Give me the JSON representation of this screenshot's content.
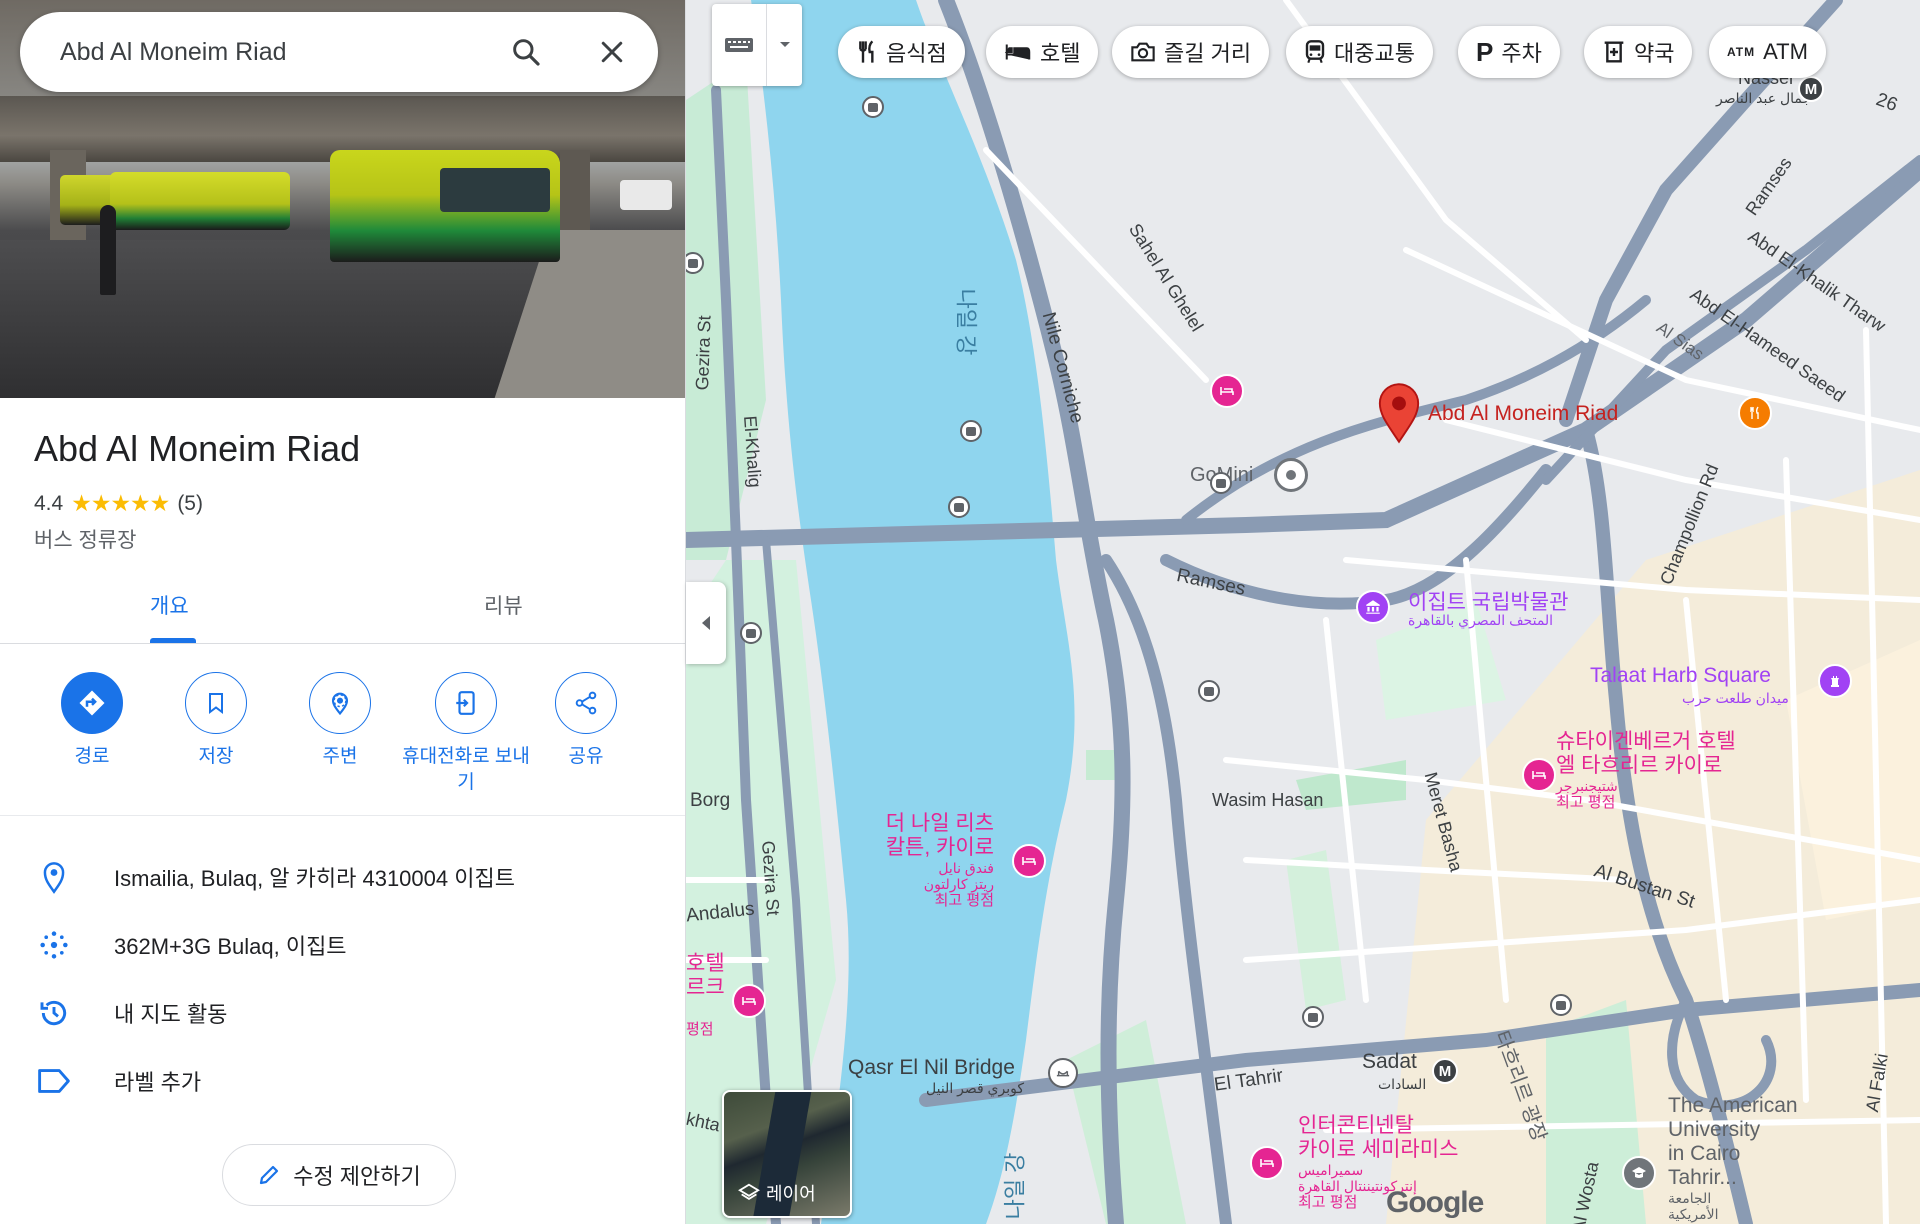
{
  "search": {
    "value": "Abd Al Moneim Riad",
    "search_icon": "search-icon",
    "close_icon": "close-icon"
  },
  "place": {
    "title": "Abd Al Moneim Riad",
    "rating": "4.4",
    "stars": "★★★★★",
    "review_count": "(5)",
    "category": "버스 정류장"
  },
  "tabs": [
    {
      "label": "개요",
      "active": true
    },
    {
      "label": "리뷰",
      "active": false
    }
  ],
  "actions": [
    {
      "label": "경로",
      "icon": "directions-icon"
    },
    {
      "label": "저장",
      "icon": "bookmark-icon"
    },
    {
      "label": "주변",
      "icon": "nearby-icon"
    },
    {
      "label": "휴대전화로 보내기",
      "icon": "send-to-phone-icon"
    },
    {
      "label": "공유",
      "icon": "share-icon"
    }
  ],
  "info": [
    {
      "icon": "location-pin-icon",
      "text": "Ismailia, Bulaq, 알 카히라 4310004 이집트"
    },
    {
      "icon": "plus-code-icon",
      "text": "362M+3G Bulaq, 이집트"
    },
    {
      "icon": "history-icon",
      "text": "내 지도 활동"
    },
    {
      "icon": "label-icon",
      "text": "라벨 추가"
    }
  ],
  "suggest_edit": "수정 제안하기",
  "map": {
    "chips": [
      {
        "label": "음식점",
        "icon": "restaurant-icon"
      },
      {
        "label": "호텔",
        "icon": "hotel-icon"
      },
      {
        "label": "즐길 거리",
        "icon": "camera-icon"
      },
      {
        "label": "대중교통",
        "icon": "transit-icon"
      },
      {
        "label": "주차",
        "icon": "parking-icon"
      },
      {
        "label": "약국",
        "icon": "pharmacy-icon"
      },
      {
        "label": "ATM",
        "icon": "atm-icon"
      }
    ],
    "layers_label": "레이어",
    "labels": {
      "nile_kr": "나일 강",
      "nile_kr_bottom": "나일 강",
      "nile_corniche": "Nile Corniche",
      "sahel": "Sahel Al Ghelel",
      "gezira_st_top": "Gezira St",
      "gezira_st_bottom": "Gezira St",
      "el_khalig": "El-Khalig",
      "gomini": "GoMini",
      "selected_place": "Abd Al Moneim Riad",
      "ramses_road": "Ramses",
      "ramses_street": "Ramses",
      "abd_el_khalik": "Abd El-Khalik Tharw",
      "abd_el_hameed": "Abd El-Hameed Saeed",
      "al_sias": "Al Sias",
      "champollion": "Champollion Rd",
      "museum_kr": "이집트 국립박물관",
      "museum_ar": "المتحف المصري بالقاهرة",
      "talaat_en": "Talaat Harb Square",
      "talaat_ar": "ميدان طلعت حرب",
      "steigen_1": "슈타이겐베르거 호텔",
      "steigen_2": "엘 타흐리르 카이로",
      "steigen_ar": "شتيجنبرجر",
      "steigen_rating": "최고 평점",
      "ritz_1": "더 나일 리츠",
      "ritz_2": "칼튼, 카이로",
      "ritz_ar1": "فندق نايل",
      "ritz_ar2": "ريتز كارلتون",
      "ritz_rating": "최고 평점",
      "wasim": "Wasim Hasan",
      "meret": "Meret Basha",
      "al_bustan": "Al Bustan St",
      "borg": "Borg",
      "andalus": "Andalus",
      "hotel_left_1": "호텔",
      "hotel_left_2": "르크",
      "hotel_left_rating": "평점",
      "qasr_en": "Qasr El Nil Bridge",
      "qasr_ar": "كوبري قصر النيل",
      "el_tahrir": "El Tahrir",
      "sadat_en": "Sadat",
      "sadat_ar": "السادات",
      "tahrir_kr": "타흐리르 광장",
      "intercon_1": "인터콘티넨탈",
      "intercon_2": "카이로 세미라미스",
      "intercon_ar1": "سميراميس",
      "intercon_ar2": "إنتركونتيننتال القاهرة",
      "intercon_rating": "최고 평점",
      "al_wosta": "Al Wosta",
      "auc_1": "The American",
      "auc_2": "University",
      "auc_3": "in Cairo",
      "auc_4": "Tahrir...",
      "auc_ar1": "الجامعة",
      "auc_ar2": "الأمريكية",
      "al_falki": "Al Falki",
      "nasser_en": "Nasser",
      "nasser_ar": "جمال عبد الناصر",
      "num_26": "26",
      "el_khta": "khta",
      "google": "Google"
    }
  }
}
